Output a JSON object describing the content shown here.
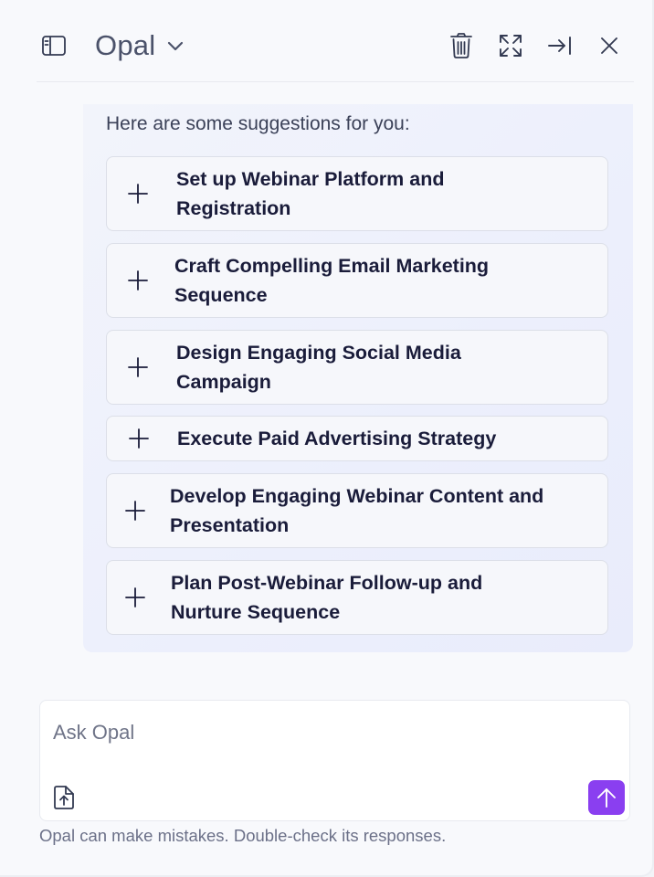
{
  "header": {
    "title": "Opal",
    "icons": {
      "sidebar_toggle": "sidebar-panel-icon",
      "title_menu": "chevron-down-icon",
      "clear": "trash-icon",
      "expand": "expand-arrows-icon",
      "collapse": "arrow-right-to-bar-icon",
      "close": "close-icon"
    }
  },
  "suggestions": {
    "intro": "Here are some suggestions for you:",
    "items": [
      {
        "line1": "Set up Webinar Platform and",
        "line2": "Registration"
      },
      {
        "line1": "Craft Compelling Email Marketing",
        "line2": "Sequence"
      },
      {
        "line1": "Design Engaging Social Media",
        "line2": "Campaign"
      },
      {
        "line1": "Execute Paid Advertising Strategy",
        "line2": ""
      },
      {
        "line1": "Develop Engaging Webinar Content and",
        "line2": "Presentation"
      },
      {
        "line1": "Plan Post-Webinar Follow-up and",
        "line2": "Nurture Sequence"
      }
    ],
    "item_icon": "plus-icon"
  },
  "composer": {
    "placeholder": "Ask Opal",
    "value": "",
    "upload_icon": "file-upload-icon",
    "send_icon": "arrow-up-icon"
  },
  "footer": {
    "disclaimer": "Opal can make mistakes. Double-check its responses."
  },
  "colors": {
    "accent": "#8a3ff0",
    "text_dark": "#1a1c3a",
    "text_muted": "#6b7088",
    "panel_bg": "#f8f9fc",
    "suggestion_bg": "#eceffc"
  }
}
